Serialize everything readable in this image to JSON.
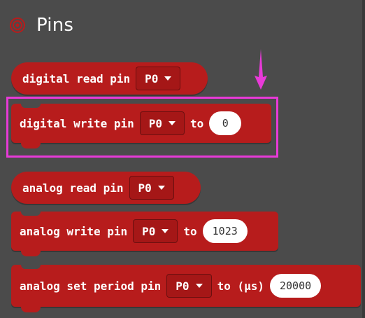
{
  "category": {
    "title": "Pins",
    "icon": "pins-target-icon",
    "color": "#b71c1c"
  },
  "colors": {
    "block": "#b71c1c",
    "dropdown_bg": "#a51717",
    "highlight": "#e83ad8",
    "arrow": "#e83ad8",
    "background": "#4b4b4b"
  },
  "blocks": {
    "digital_read": {
      "label": "digital read pin",
      "pin": "P0"
    },
    "digital_write": {
      "label": "digital write pin",
      "pin": "P0",
      "to": "to",
      "value": "0"
    },
    "analog_read": {
      "label": "analog read pin",
      "pin": "P0"
    },
    "analog_write": {
      "label": "analog write pin",
      "pin": "P0",
      "to": "to",
      "value": "1023"
    },
    "analog_set_period": {
      "label": "analog set period pin",
      "pin": "P0",
      "to": "to (µs)",
      "value": "20000"
    }
  }
}
